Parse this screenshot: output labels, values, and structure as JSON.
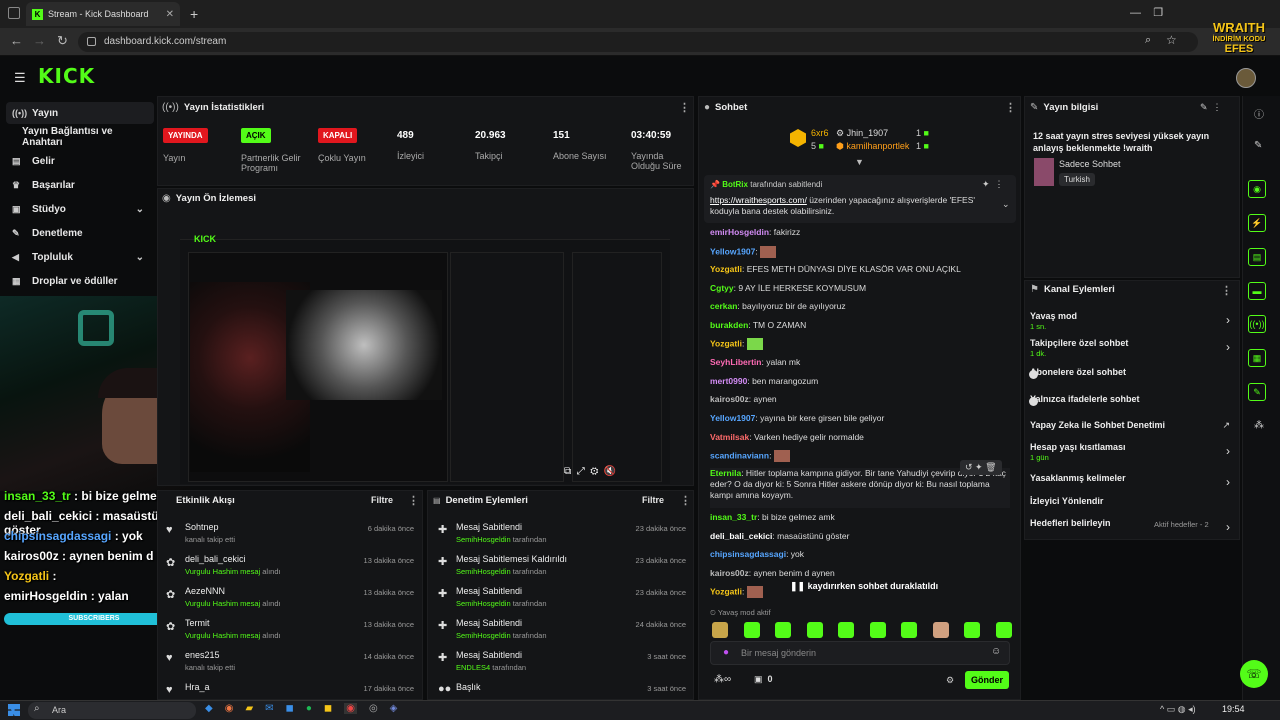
{
  "browser": {
    "tab_title": "Stream - Kick Dashboard",
    "url": "dashboard.kick.com/stream"
  },
  "logo": "KICK",
  "sidebar": {
    "items": [
      {
        "label": "Yayın",
        "icon": "broadcast-icon"
      },
      {
        "label": "Yayın Bağlantısı ve Anahtarı",
        "icon": ""
      },
      {
        "label": "Gelir",
        "icon": "money-icon"
      },
      {
        "label": "Başarılar",
        "icon": "trophy-icon"
      },
      {
        "label": "Stüdyo",
        "icon": "studio-icon"
      },
      {
        "label": "Denetleme",
        "icon": "wrench-icon"
      },
      {
        "label": "Topluluk",
        "icon": "megaphone-icon"
      },
      {
        "label": "Droplar ve ödüller",
        "icon": "drop-icon"
      }
    ]
  },
  "stats": {
    "title": "Yayın İstatistikleri",
    "items": [
      {
        "badge": "YAYINDA",
        "label": "Yayın"
      },
      {
        "badge": "AÇIK",
        "label": "Partnerlik Gelir Programı"
      },
      {
        "badge": "KAPALI",
        "label": "Çoklu Yayın"
      },
      {
        "value": "489",
        "label": "İzleyici"
      },
      {
        "value": "20.963",
        "label": "Takipçi"
      },
      {
        "value": "151",
        "label": "Abone Sayısı"
      },
      {
        "value": "03:40:59",
        "label": "Yayında Olduğu Süre"
      }
    ]
  },
  "preview": {
    "title": "Yayın Ön İzlemesi"
  },
  "activity": {
    "title": "Etkinlik Akışı",
    "filter": "Filtre",
    "rows": [
      {
        "name": "Sohtnep",
        "sub": "kanalı takip etti",
        "time": "6 dakika önce"
      },
      {
        "name": "deli_bali_cekici",
        "sub": "Vurgulu Hashim mesaj",
        "sub2": "alındı",
        "time": "13 dakika önce"
      },
      {
        "name": "AezeNNN",
        "sub": "Vurgulu Hashim mesaj",
        "sub2": "alındı",
        "time": "13 dakika önce"
      },
      {
        "name": "Termit",
        "sub": "Vurgulu Hashim mesaj",
        "sub2": "alındı",
        "time": "13 dakika önce"
      },
      {
        "name": "enes215",
        "sub": "kanalı takip etti",
        "time": "14 dakika önce"
      },
      {
        "name": "Hra_a",
        "sub": "",
        "time": "17 dakika önce"
      }
    ]
  },
  "moderation": {
    "title": "Denetim Eylemleri",
    "filter": "Filtre",
    "rows": [
      {
        "name": "Mesaj Sabitlendi",
        "by": "SemihHosgeldin",
        "sub": "tarafından",
        "time": "23 dakika önce"
      },
      {
        "name": "Mesaj Sabitlemesi Kaldırıldı",
        "by": "SemihHosgeldin",
        "sub": "tarafından",
        "time": "23 dakika önce"
      },
      {
        "name": "Mesaj Sabitlendi",
        "by": "SemihHosgeldin",
        "sub": "tarafından",
        "time": "23 dakika önce"
      },
      {
        "name": "Mesaj Sabitlendi",
        "by": "SemihHosgeldin",
        "sub": "tarafından",
        "time": "24 dakika önce"
      },
      {
        "name": "Mesaj Sabitlendi",
        "by": "ENDLES4",
        "sub": "tarafından",
        "time": "3 saat önce"
      },
      {
        "name": "Başlık",
        "by": "",
        "sub": "",
        "time": "3 saat önce"
      }
    ]
  },
  "chat": {
    "title": "Sohbet",
    "top1": {
      "name": "6xr6",
      "count": "5"
    },
    "top2": {
      "name": "Jhin_1907",
      "count": "1"
    },
    "top3": {
      "name": "kamilhanportlek",
      "count": "1"
    },
    "pinned": {
      "by": "BotRix",
      "by_suffix": "tarafından sabitlendi",
      "link": "https://wraithesports.com/",
      "text1": " üzerinden yapacağınız alışverişlerde",
      "text2": "'EFES' koduyla bana destek olabilirsiniz."
    },
    "messages": [
      {
        "user": "emirHosgeldin",
        "text": "fakirizz",
        "color": "#d38cf5"
      },
      {
        "user": "Yellow1907",
        "text": "",
        "color": "#57a6ff"
      },
      {
        "user": "Yozgatli",
        "text": "EFES METH DÜNYASI DİYE KLASÖR VAR ONU AÇIKL",
        "color": "#f5c518"
      },
      {
        "user": "Cgtyy",
        "text": "9 AY İLE HERKESE KOYMUSUM",
        "color": "#53fc18"
      },
      {
        "user": "cerkan",
        "text": "bayılıyoruz bir de ayılıyoruz",
        "color": "#53fc18"
      },
      {
        "user": "burakden",
        "text": "TM O ZAMAN",
        "color": "#53fc18"
      },
      {
        "user": "Yozgatli",
        "text": "",
        "color": "#f5c518"
      },
      {
        "user": "SeyhLibertin",
        "text": "yalan mk",
        "color": "#ff6bb5"
      },
      {
        "user": "mert0990",
        "text": "ben marangozum",
        "color": "#d38cf5"
      },
      {
        "user": "kairos00z",
        "text": "aynen",
        "color": "#bbbbbb"
      },
      {
        "user": "Yellow1907",
        "text": "yayına bir kere girsen bile geliyor",
        "color": "#57a6ff"
      },
      {
        "user": "Vatmilsak",
        "text": "Varken hediye gelir normalde",
        "color": "#ff6b6b"
      },
      {
        "user": "scandinaviann",
        "text": "",
        "color": "#57a6ff"
      },
      {
        "user": "Eternila",
        "text": "Hitler toplama kampına gidiyor. Bir tane Yahudiyi çevirip diyor 1 2 kaç eder? O da diyor ki: 5 Sonra Hitler askere dönüp diyor ki: Bu nasıl toplama kampı amına koyaym.",
        "color": "#53fc18"
      },
      {
        "user": "insan_33_tr",
        "text": "bi bize gelmez amk",
        "color": "#53fc18"
      },
      {
        "user": "deli_bali_cekici",
        "text": "masaüstünü göster",
        "color": "#ffffff"
      },
      {
        "user": "chipsinsagdassagi",
        "text": "yok",
        "color": "#57a6ff"
      },
      {
        "user": "kairos00z",
        "text": "aynen benim d aynen",
        "color": "#bbbbbb"
      },
      {
        "user": "Yozgatli",
        "text": "",
        "color": "#f5c518"
      }
    ],
    "paused": "kaydırırken sohbet duraklatıldı",
    "slow": "Yavaş mod aktif",
    "placeholder": "Bir mesaj gönderin",
    "send": "Gönder",
    "points": "0"
  },
  "info": {
    "title": "Yayın bilgisi",
    "stream_title": "12 saat yayın stres seviyesi yüksek yayın anlayış beklenmekte !wraith",
    "category": "Sadece Sohbet",
    "lang": "Turkish"
  },
  "actions": {
    "title": "Kanal Eylemleri",
    "items": [
      {
        "label": "Yavaş mod",
        "sub": "1 sn."
      },
      {
        "label": "Takipçilere özel sohbet",
        "sub": "1 dk."
      },
      {
        "label": "Abonelere özel sohbet",
        "sub": ""
      },
      {
        "label": "Yalnızca ifadelerle sohbet",
        "sub": ""
      },
      {
        "label": "Yapay Zeka ile Sohbet Denetimi",
        "sub": ""
      },
      {
        "label": "Hesap yaşı kısıtlaması",
        "sub": "1 gün"
      },
      {
        "label": "Yasaklanmış kelimeler",
        "sub": ""
      },
      {
        "label": "İzleyici Yönlendir",
        "sub": ""
      },
      {
        "label": "Hedefleri belirleyin",
        "sub": "Aktif hedefler - 2"
      }
    ]
  },
  "overlay": {
    "chat": [
      {
        "user": "insan_33_tr",
        "text": "bi bize gelmez amk"
      },
      {
        "user": "deli_bali_cekici",
        "text": "masaüstünü göster"
      },
      {
        "user": "chipsinsagdassagi",
        "text": "yok"
      },
      {
        "user": "kairos00z",
        "text": "aynen benim d aynen"
      },
      {
        "user": "Yozgatli",
        "text": ""
      },
      {
        "user": "emirHosgeldin",
        "text": "yalan"
      }
    ],
    "subs": "SUBSCRIBERS",
    "brand1": "WRAITH",
    "brand2": "İNDİRİM KODU",
    "brand3": "EFES"
  },
  "taskbar": {
    "search": "Ara",
    "time": "19:54"
  }
}
